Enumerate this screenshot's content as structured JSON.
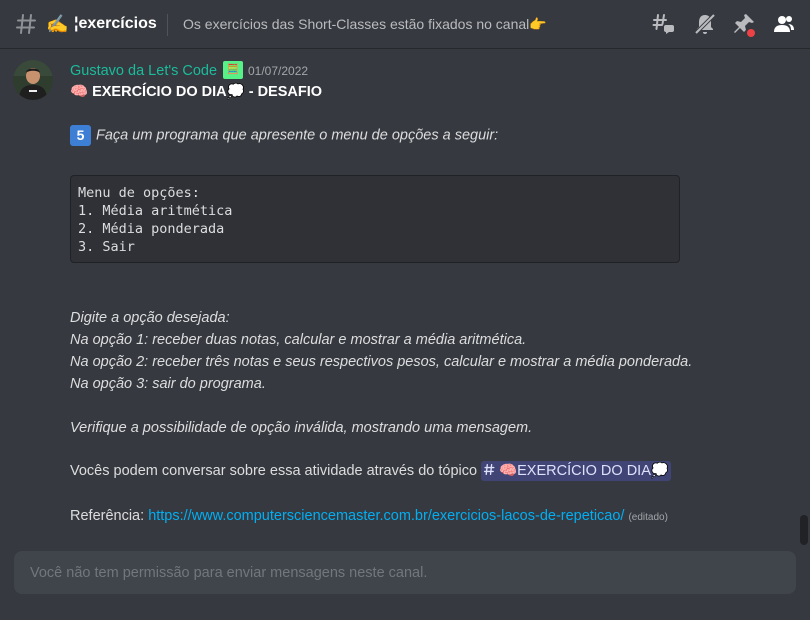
{
  "header": {
    "channel_emoji": "✍️",
    "channel_name": "¦exercícios",
    "topic": "Os exercícios das Short-Classes estão fixados no canal",
    "topic_emoji": "👉"
  },
  "message": {
    "username": "Gustavo da Let's Code",
    "role_badge": "🧮",
    "timestamp": "01/07/2022",
    "title": {
      "emoji_start": "🧠",
      "text": "EXERCÍCIO DO DIA",
      "emoji_mid": "💭",
      "suffix": " - DESAFIO"
    },
    "number_badge": "5",
    "intro": "Faça um programa que apresente o menu de opções a seguir:",
    "code_lines": [
      "Menu de opções:",
      "1. Média aritmética",
      "2. Média ponderada",
      "3. Sair"
    ],
    "italic_lines": [
      "Digite a opção desejada:",
      "Na opção 1: receber duas notas, calcular e mostrar a média aritmética.",
      "Na opção 2: receber três notas e seus respectivos pesos, calcular e mostrar a média ponderada.",
      "Na opção 3: sair do programa."
    ],
    "verify_line": "Verifique a possibilidade de opção inválida, mostrando uma mensagem.",
    "conversation_prefix": "Vocês podem conversar sobre essa atividade através do tópico ",
    "channel_mention": "🧠EXERCÍCIO DO DIA💭",
    "reference_label": "Referência: ",
    "reference_url": "https://www.computersciencemaster.com.br/exercicios-lacos-de-repeticao/",
    "edited_label": "(editado)"
  },
  "composer": {
    "placeholder": "Você não tem permissão para enviar mensagens neste canal."
  },
  "colors": {
    "background": "#36393f",
    "username": "#1abc9c",
    "link": "#00aff4",
    "mention_bg": "rgba(88,101,242,0.3)"
  }
}
